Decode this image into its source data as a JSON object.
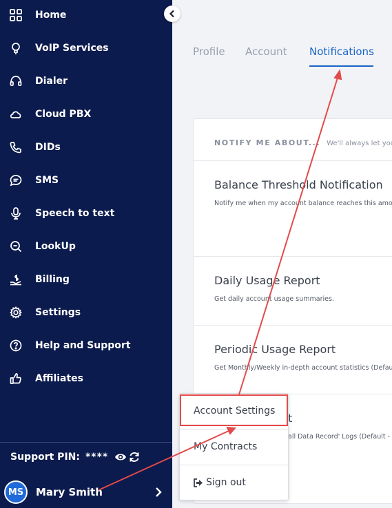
{
  "sidebar": {
    "items": [
      {
        "label": "Home",
        "icon": "grid-icon"
      },
      {
        "label": "VoIP Services",
        "icon": "bulb-icon"
      },
      {
        "label": "Dialer",
        "icon": "headset-icon"
      },
      {
        "label": "Cloud PBX",
        "icon": "cloud-phone-icon"
      },
      {
        "label": "DIDs",
        "icon": "phone-icon"
      },
      {
        "label": "SMS",
        "icon": "chat-icon"
      },
      {
        "label": "Speech to text",
        "icon": "microphone-icon"
      },
      {
        "label": "LookUp",
        "icon": "search-icon"
      },
      {
        "label": "Billing",
        "icon": "billing-icon"
      },
      {
        "label": "Settings",
        "icon": "gear-icon"
      },
      {
        "label": "Help and Support",
        "icon": "question-icon"
      },
      {
        "label": "Affiliates",
        "icon": "thumbs-up-icon"
      }
    ],
    "support_label": "Support PIN:",
    "support_pin": "****",
    "user": {
      "initials": "MS",
      "name": "Mary Smith"
    }
  },
  "tabs": [
    {
      "label": "Profile",
      "active": false
    },
    {
      "label": "Account",
      "active": false
    },
    {
      "label": "Notifications",
      "active": true
    }
  ],
  "card": {
    "heading": "NOTIFY ME ABOUT...",
    "subheading": "We'll always let you know",
    "sections": [
      {
        "title": "Balance Threshold Notification",
        "desc": "Notify me when my account balance reaches this amo"
      },
      {
        "title": "Daily Usage Report",
        "desc": "Get daily account usage summaries."
      },
      {
        "title": "Periodic Usage Report",
        "desc": "Get Monthly/Weekly in-depth account statistics (Defau"
      },
      {
        "title": "t",
        "desc": "all Data Record' Logs (Default -"
      }
    ]
  },
  "menu": {
    "items": [
      {
        "label": "Account Settings"
      },
      {
        "label": "My Contracts"
      },
      {
        "label": "Sign out",
        "icon": "sign-out-icon"
      }
    ]
  },
  "colors": {
    "sidebar_bg": "#0c1b4d",
    "accent": "#1763c6",
    "annotation": "#e34a4a",
    "avatar_bg": "#1f6ad8"
  }
}
